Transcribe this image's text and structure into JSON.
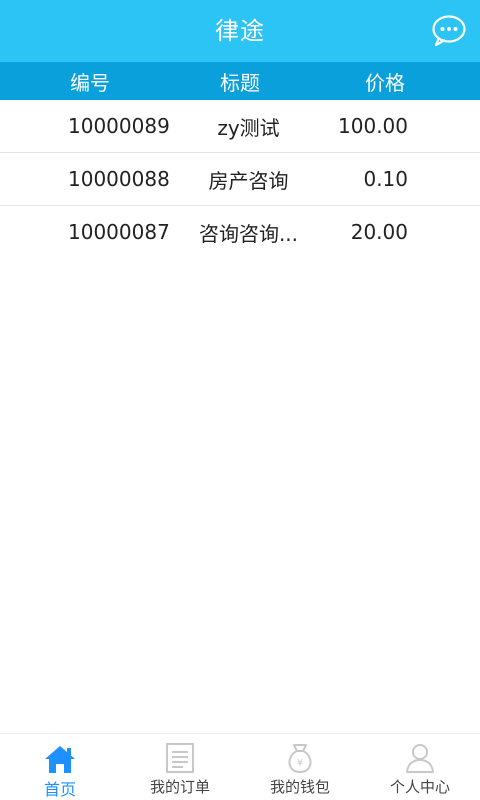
{
  "app_title": "律途",
  "header": {
    "columns": [
      "编号",
      "标题",
      "价格"
    ]
  },
  "orders": [
    {
      "id": "10000089",
      "title": "zy测试",
      "price": "100.00"
    },
    {
      "id": "10000088",
      "title": "房产咨询",
      "price": "0.10"
    },
    {
      "id": "10000087",
      "title": "咨询咨询...",
      "price": "20.00"
    }
  ],
  "tabs": [
    {
      "label": "首页",
      "icon": "home-icon",
      "active": true
    },
    {
      "label": "我的订单",
      "icon": "document-icon",
      "active": false
    },
    {
      "label": "我的钱包",
      "icon": "money-bag-icon",
      "active": false
    },
    {
      "label": "个人中心",
      "icon": "person-icon",
      "active": false
    }
  ],
  "colors": {
    "topbar": "#2bc4f5",
    "header_row": "#0aa0dc",
    "active_tab": "#1e90ff",
    "inactive_icon": "#c8c8c8"
  }
}
